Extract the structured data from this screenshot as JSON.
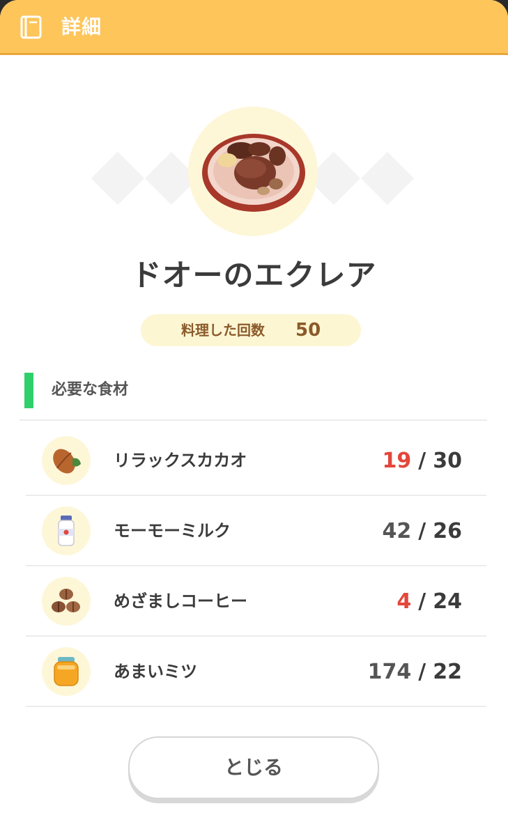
{
  "header": {
    "title": "詳細",
    "icon": "book-icon"
  },
  "recipe": {
    "name": "ドオーのエクレア",
    "count_label": "料理した回数",
    "count_value": "50"
  },
  "ingredients_section": {
    "title": "必要な食材",
    "items": [
      {
        "name": "リラックスカカオ",
        "have": "19",
        "need": "30",
        "sufficient": false,
        "icon": "cacao-icon"
      },
      {
        "name": "モーモーミルク",
        "have": "42",
        "need": "26",
        "sufficient": true,
        "icon": "milk-bottle-icon"
      },
      {
        "name": "めざましコーヒー",
        "have": "4",
        "need": "24",
        "sufficient": false,
        "icon": "coffee-beans-icon"
      },
      {
        "name": "あまいミツ",
        "have": "174",
        "need": "22",
        "sufficient": true,
        "icon": "honey-jar-icon"
      }
    ],
    "separator": "/"
  },
  "close_button": {
    "label": "とじる"
  },
  "colors": {
    "header": "#fdc55a",
    "accent_green": "#2fd06c",
    "shortage_red": "#e4463a",
    "pill": "#fdf6d3"
  }
}
